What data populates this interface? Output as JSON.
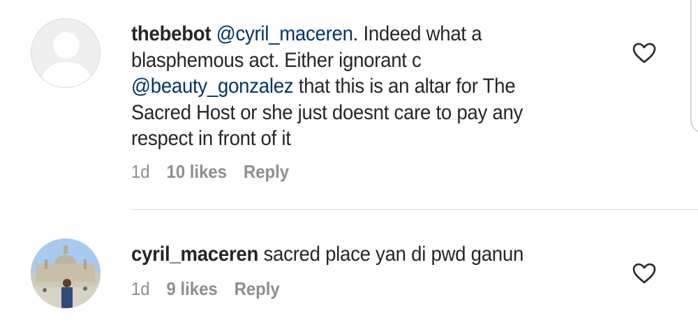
{
  "comments": [
    {
      "username": "thebebot",
      "text_parts": [
        {
          "type": "mention",
          "text": "@cyril_maceren"
        },
        {
          "type": "text",
          "text": ". Indeed what a blasphemous act. Either ignorant c "
        },
        {
          "type": "mention",
          "text": "@beauty_gonzalez"
        },
        {
          "type": "text",
          "text": " that this is an altar for The Sacred Host or she just doesnt care to pay any respect in front of it"
        }
      ],
      "time": "1d",
      "likes": "10 likes",
      "reply_label": "Reply",
      "avatar": "default-profile-icon",
      "like_icon": "heart-outline-icon"
    },
    {
      "username": "cyril_maceren",
      "text_parts": [
        {
          "type": "text",
          "text": "sacred place yan di pwd ganun"
        }
      ],
      "time": "1d",
      "likes": "9 likes",
      "reply_label": "Reply",
      "avatar": "profile-photo",
      "like_icon": "heart-outline-icon"
    }
  ],
  "colors": {
    "text": "#262626",
    "mention": "#003569",
    "meta": "#8e8e8e",
    "divider": "#dbdbdb"
  }
}
